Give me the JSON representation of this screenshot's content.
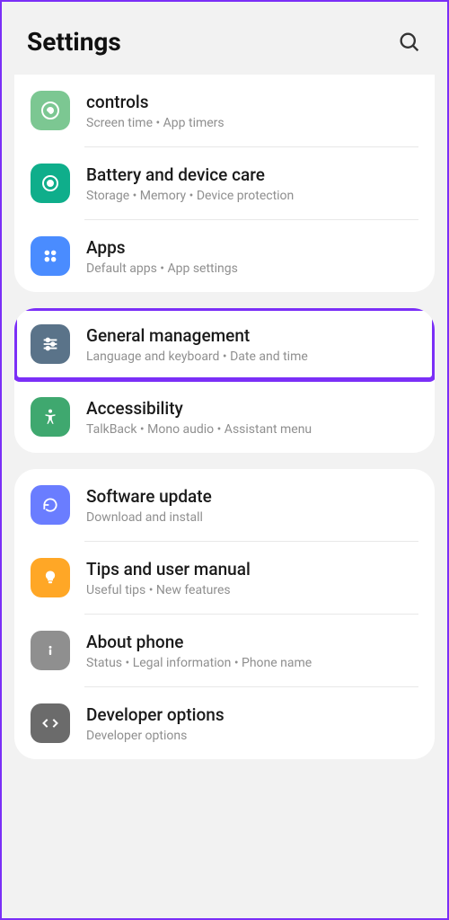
{
  "header": {
    "title": "Settings"
  },
  "groups": [
    {
      "items": [
        {
          "icon": "wellbeing",
          "color": "green1",
          "title": "controls",
          "sub": "Screen time  •  App timers"
        },
        {
          "icon": "battery",
          "color": "green2",
          "title": "Battery and device care",
          "sub": "Storage  •  Memory  •  Device protection"
        },
        {
          "icon": "apps",
          "color": "blue1",
          "title": "Apps",
          "sub": "Default apps  •  App settings"
        }
      ]
    },
    {
      "items": [
        {
          "icon": "sliders",
          "color": "slate",
          "title": "General management",
          "sub": "Language and keyboard  •  Date and time",
          "highlighted": true
        },
        {
          "icon": "accessibility",
          "color": "green3",
          "title": "Accessibility",
          "sub": "TalkBack  •  Mono audio  •  Assistant menu"
        }
      ]
    },
    {
      "items": [
        {
          "icon": "update",
          "color": "blue2",
          "title": "Software update",
          "sub": "Download and install"
        },
        {
          "icon": "tips",
          "color": "orange",
          "title": "Tips and user manual",
          "sub": "Useful tips  •  New features"
        },
        {
          "icon": "about",
          "color": "gray",
          "title": "About phone",
          "sub": "Status  •  Legal information  •  Phone name"
        },
        {
          "icon": "dev",
          "color": "gray2",
          "title": "Developer options",
          "sub": "Developer options"
        }
      ]
    }
  ]
}
